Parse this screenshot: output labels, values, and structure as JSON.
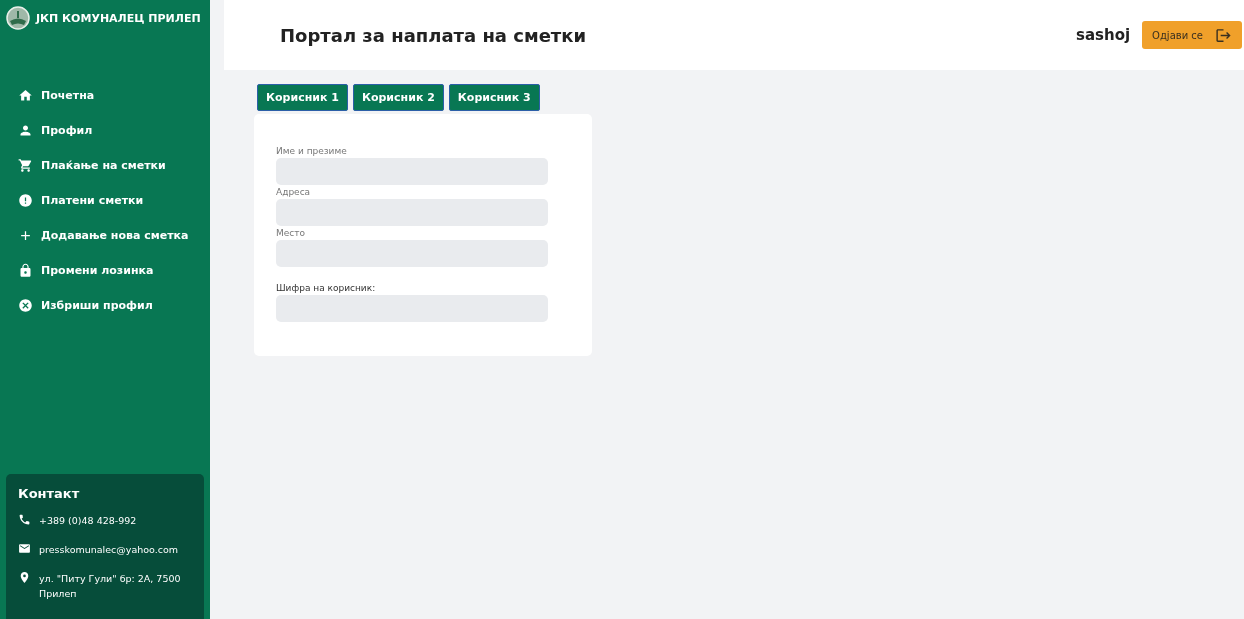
{
  "brand": {
    "name": "ЈКП КОМУНАЛЕЦ ПРИЛЕП"
  },
  "nav": [
    {
      "kind": "home",
      "label": "Почетна"
    },
    {
      "kind": "person",
      "label": "Профил"
    },
    {
      "kind": "cart",
      "label": "Плаќање на сметки"
    },
    {
      "kind": "alert",
      "label": "Платени сметки"
    },
    {
      "kind": "add",
      "label": "Додавање нова сметка"
    },
    {
      "kind": "lock",
      "label": "Промени лозинка"
    },
    {
      "kind": "delete",
      "label": "Избриши профил"
    }
  ],
  "contact": {
    "title": "Контакт",
    "items": [
      {
        "kind": "phone",
        "text": "+389 (0)48 428-992"
      },
      {
        "kind": "email",
        "text": "presskomunalec@yahoo.com"
      },
      {
        "kind": "location",
        "text": "ул. \"Питу Гули\" бр: 2А, 7500 Прилеп"
      }
    ]
  },
  "header": {
    "title": "Портал за наплата на сметки",
    "user": "sashoj",
    "logout": "Одјави се"
  },
  "tabs": [
    {
      "label": "Корисник 1"
    },
    {
      "label": "Корисник 2"
    },
    {
      "label": "Корисник 3"
    }
  ],
  "form": {
    "fields": [
      {
        "label": "Име и презиме",
        "kind": "light"
      },
      {
        "label": "Адреса",
        "kind": "light"
      },
      {
        "label": "Место",
        "kind": "light"
      },
      {
        "label": "Шифра на корисник:",
        "kind": "dark"
      }
    ]
  }
}
